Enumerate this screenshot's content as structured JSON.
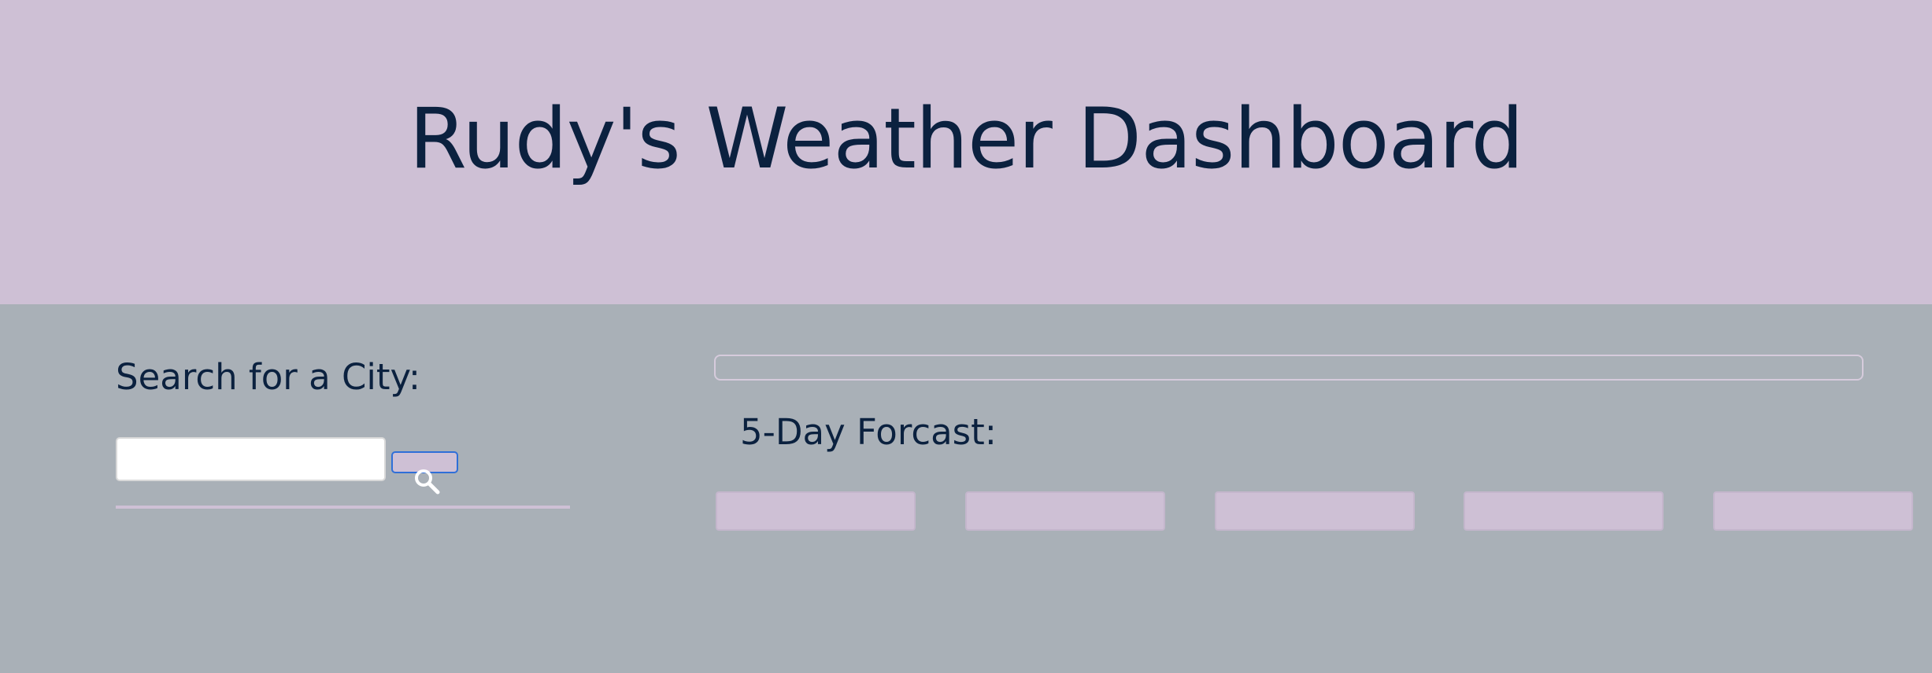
{
  "header": {
    "title": "Rudy's Weather Dashboard"
  },
  "search": {
    "label": "Search for a City:",
    "input_value": "",
    "placeholder": "",
    "button_icon": "search-icon"
  },
  "current_weather": {
    "content": ""
  },
  "forecast": {
    "title": "5-Day Forcast:",
    "cards": [
      "",
      "",
      "",
      "",
      ""
    ]
  },
  "colors": {
    "header_bg": "#cec0d5",
    "main_bg": "#a9b0b7",
    "text": "#0b213f",
    "button_border": "#2f6fd8"
  }
}
